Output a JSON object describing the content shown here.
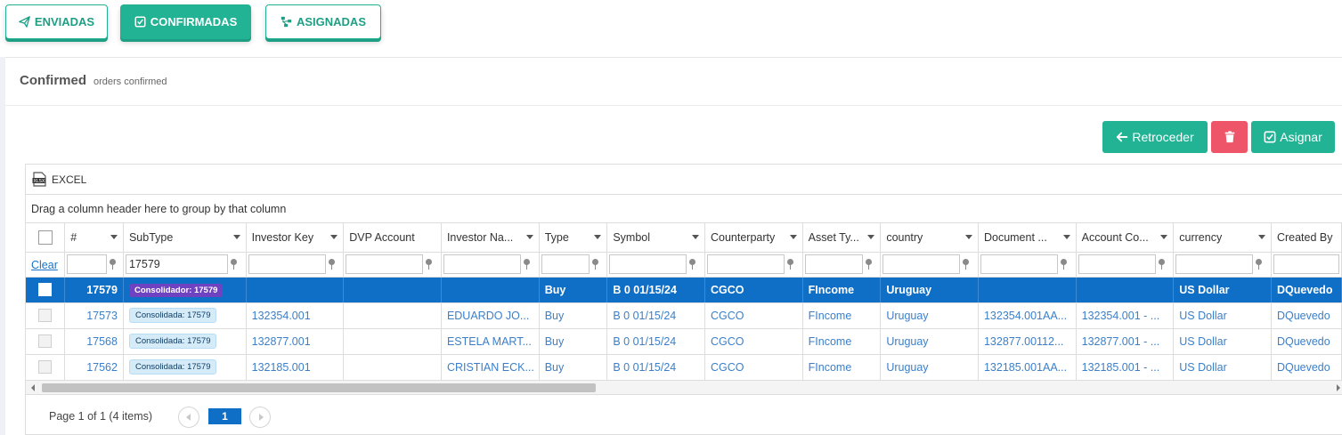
{
  "tabs": [
    {
      "label": "ENVIADAS",
      "icon": "paper-plane-icon",
      "style": "outline"
    },
    {
      "label": "CONFIRMADAS",
      "icon": "check-square-icon",
      "style": "filled"
    },
    {
      "label": "ASIGNADAS",
      "icon": "sitemap-icon",
      "style": "outline"
    }
  ],
  "page": {
    "title": "Confirmed",
    "subtitle": "orders confirmed"
  },
  "actions": {
    "back_label": "Retroceder",
    "delete_icon": "trash-icon",
    "assign_label": "Asignar"
  },
  "grid": {
    "excel_label": "EXCEL",
    "group_panel_text": "Drag a column header here to group by that column",
    "clear_label": "Clear",
    "columns": [
      "#",
      "SubType",
      "Investor Key",
      "DVP Account",
      "Investor Na...",
      "Type",
      "Symbol",
      "Counterparty",
      "Asset Ty...",
      "country",
      "Document ...",
      "Account Co...",
      "currency",
      "Created By"
    ],
    "filter_subtype": "17579",
    "rows": [
      {
        "id": "17579",
        "subtype": "Consolidador: 17579",
        "investor_key": "",
        "dvp": "",
        "investor_name": "",
        "type": "Buy",
        "symbol": "B 0 01/15/24",
        "counterparty": "CGCO",
        "asset_type": "FIncome",
        "country": "Uruguay",
        "document": "",
        "account": "",
        "currency": "US Dollar",
        "created_by": "DQuevedo",
        "selected": true
      },
      {
        "id": "17573",
        "subtype": "Consolidada: 17579",
        "investor_key": "132354.001",
        "dvp": "",
        "investor_name": "EDUARDO JO...",
        "type": "Buy",
        "symbol": "B 0 01/15/24",
        "counterparty": "CGCO",
        "asset_type": "FIncome",
        "country": "Uruguay",
        "document": "132354.001AA...",
        "account": "132354.001 - ...",
        "currency": "US Dollar",
        "created_by": "DQuevedo",
        "selected": false
      },
      {
        "id": "17568",
        "subtype": "Consolidada: 17579",
        "investor_key": "132877.001",
        "dvp": "",
        "investor_name": "ESTELA MART...",
        "type": "Buy",
        "symbol": "B 0 01/15/24",
        "counterparty": "CGCO",
        "asset_type": "FIncome",
        "country": "Uruguay",
        "document": "132877.00112...",
        "account": "132877.001 - ...",
        "currency": "US Dollar",
        "created_by": "DQuevedo",
        "selected": false
      },
      {
        "id": "17562",
        "subtype": "Consolidada: 17579",
        "investor_key": "132185.001",
        "dvp": "",
        "investor_name": "CRISTIAN ECK...",
        "type": "Buy",
        "symbol": "B 0 01/15/24",
        "counterparty": "CGCO",
        "asset_type": "FIncome",
        "country": "Uruguay",
        "document": "132185.001AA...",
        "account": "132185.001 - ...",
        "currency": "US Dollar",
        "created_by": "DQuevedo",
        "selected": false
      }
    ],
    "pager": {
      "info": "Page 1 of 1 (4 items)",
      "current_page": "1"
    }
  },
  "colors": {
    "accent": "#21b394",
    "danger": "#ee5568",
    "selected_row": "#0f6fc6",
    "badge_purple": "#6f42c1",
    "link": "#3c7fc8"
  }
}
